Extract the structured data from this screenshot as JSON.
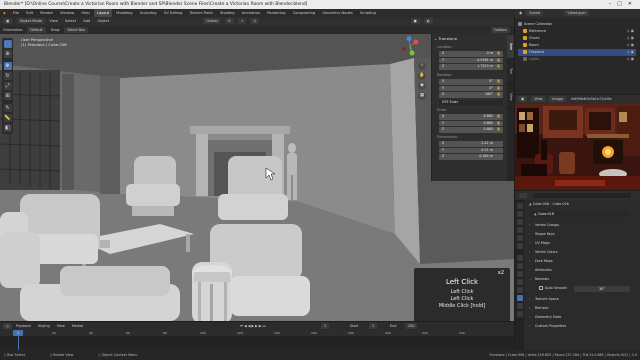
{
  "title_bar": {
    "text": "Blender* [D:\\Online Course\\Create a Victorian Room with Blender and SP\\Blender Scene Files\\Create a Victorian Room with Blender.blend]"
  },
  "menubar": {
    "menus": [
      "File",
      "Edit",
      "Render",
      "Window",
      "Help"
    ],
    "workspaces": [
      "Layout",
      "Modeling",
      "Sculpting",
      "UV Editing",
      "Texture Paint",
      "Shading",
      "Animation",
      "Rendering",
      "Compositing",
      "Geometry Nodes",
      "Scripting"
    ],
    "active_workspace": "Layout",
    "scene_label": "Scene",
    "view_layer_label": "ViewLayer"
  },
  "viewport_header": {
    "mode": "Object Mode",
    "menus": [
      "View",
      "Select",
      "Add",
      "Object"
    ],
    "orientation_label": "Global",
    "options_label": "Options"
  },
  "viewport_header2": {
    "orientation_field": "Orientation:",
    "orientation_value": "Default",
    "drag_label": "Drag:",
    "drag_value": "Select Box"
  },
  "viewport_info": {
    "line1": "User Perspective",
    "line2": "(1) Fireplace | Cube.006"
  },
  "npanel": {
    "section_transform": "Transform",
    "location_label": "Location:",
    "location": [
      {
        "axis": "X",
        "value": "0 m"
      },
      {
        "axis": "Y",
        "value": "-4.9761 m"
      },
      {
        "axis": "Z",
        "value": "1.7223 m"
      }
    ],
    "rotation_label": "Rotation:",
    "rotation": [
      {
        "axis": "X",
        "value": "0°"
      },
      {
        "axis": "Y",
        "value": "0°"
      },
      {
        "axis": "Z",
        "value": "180°"
      }
    ],
    "rotation_mode": "XYZ Euler",
    "scale_label": "Scale:",
    "scale": [
      {
        "axis": "X",
        "value": "0.865"
      },
      {
        "axis": "Y",
        "value": "0.865"
      },
      {
        "axis": "Z",
        "value": "0.865"
      }
    ],
    "dimensions_label": "Dimensions:",
    "dimensions": [
      {
        "axis": "X",
        "value": "2.41 m"
      },
      {
        "axis": "Y",
        "value": "0.21 m"
      },
      {
        "axis": "Z",
        "value": "0.264 m"
      }
    ],
    "tabs": [
      "Item",
      "Tool",
      "View"
    ]
  },
  "screencast_keys": {
    "count": "x2",
    "main": "Left Click",
    "lines": [
      "Left Click",
      "Left Click",
      "Middle Click [hold]"
    ]
  },
  "timeline": {
    "menus": [
      "Playback",
      "Keying",
      "View",
      "Marker"
    ],
    "current_frame": "1",
    "start_label": "Start",
    "start_value": "1",
    "end_label": "End",
    "end_value": "250",
    "ticks": [
      "1",
      "20",
      "40",
      "60",
      "80",
      "100",
      "120",
      "140",
      "160",
      "180",
      "200",
      "220",
      "240"
    ]
  },
  "statusbar": {
    "select": "Box Select",
    "rotate": "Rotate View",
    "context": "Object Context Menu",
    "stats": "Fireplace | Cube.006 | Verts:159.805 | Faces:157.264 | Tris:314.588 | Objects:4/22 | 3.4"
  },
  "outliner": {
    "header": "Scene Collection",
    "items": [
      {
        "name": "Scene Collection"
      },
      {
        "name": "Reference"
      },
      {
        "name": "Chairs"
      },
      {
        "name": "Room"
      },
      {
        "name": "Fireplace"
      },
      {
        "name": "Lights"
      }
    ]
  },
  "image_editor": {
    "menus": [
      "View",
      "Image"
    ],
    "image_name": "fd499b4f0c5b1e71cb5e"
  },
  "properties": {
    "object_name": "Cube.006",
    "data_name": "Cube.016",
    "mesh_name": "Cube.016",
    "panels": [
      "Vertex Groups",
      "Shape Keys",
      "UV Maps",
      "Vertex Colors",
      "Face Maps",
      "Attributes",
      "Normals",
      "Texture Space",
      "Remesh",
      "Geometry Data",
      "Custom Properties"
    ],
    "auto_smooth_label": "Auto Smooth",
    "auto_smooth_value": "30°"
  },
  "colors": {
    "accent": "#4772b3",
    "viewport_bg": "#3b3b3b",
    "panel_bg": "#2b2b2b"
  }
}
